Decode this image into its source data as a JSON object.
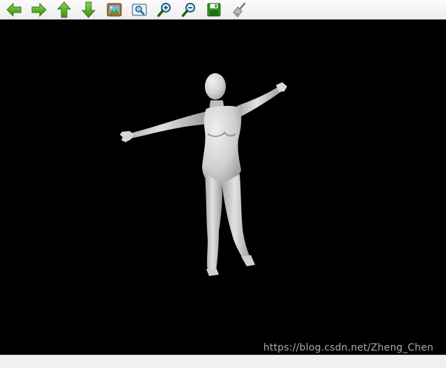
{
  "toolbar": {
    "buttons": [
      {
        "icon": "arrow-left-icon"
      },
      {
        "icon": "arrow-right-icon"
      },
      {
        "icon": "arrow-up-icon"
      },
      {
        "icon": "arrow-down-icon"
      },
      {
        "icon": "picture-icon"
      },
      {
        "icon": "zoom-fit-icon"
      },
      {
        "icon": "zoom-in-icon"
      },
      {
        "icon": "zoom-out-icon"
      },
      {
        "icon": "save-icon"
      },
      {
        "icon": "clear-brush-icon"
      }
    ]
  },
  "viewport": {
    "background": "#000000",
    "model": "human-body-mesh",
    "watermark": "https://blog.csdn.net/Zheng_Chen"
  },
  "colors": {
    "icon_green": "#3f9a1c",
    "icon_green_light": "#7ccd3c",
    "mesh": "#d4d4d4"
  }
}
